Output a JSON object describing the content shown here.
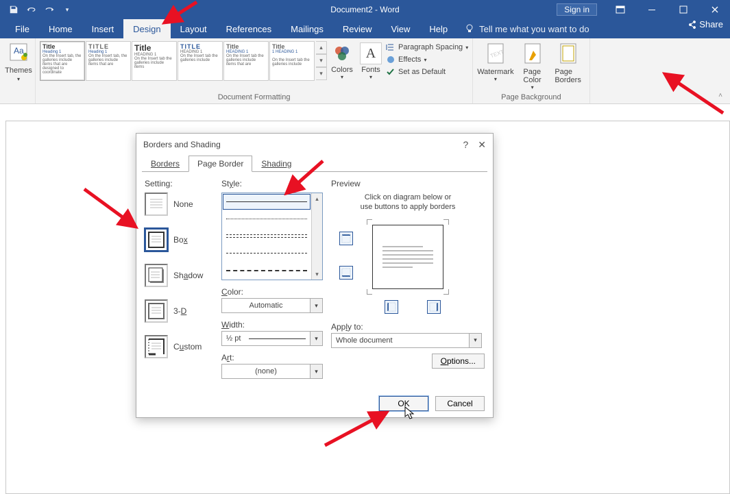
{
  "titlebar": {
    "title": "Document2 - Word",
    "signin": "Sign in"
  },
  "tabs": {
    "file": "File",
    "home": "Home",
    "insert": "Insert",
    "design": "Design",
    "layout": "Layout",
    "references": "References",
    "mailings": "Mailings",
    "review": "Review",
    "view": "View",
    "help": "Help",
    "tellme": "Tell me what you want to do",
    "share": "Share"
  },
  "ribbon": {
    "themes": "Themes",
    "group_docfmt": "Document Formatting",
    "colors": "Colors",
    "fonts": "Fonts",
    "para_spacing": "Paragraph Spacing",
    "effects": "Effects",
    "set_default": "Set as Default",
    "watermark": "Watermark",
    "page_color": "Page Color",
    "page_borders": "Page Borders",
    "group_pagebg": "Page Background",
    "gal_title1": "Title",
    "gal_heading1": "Heading 1",
    "gal_title2": "TITLE",
    "gal_title3": "Title",
    "gal_heading3": "HEADING 1",
    "gal_title4": "TITLE",
    "gal_heading4": "HEADING 1",
    "gal_title5": "Title",
    "gal_heading5": "HEADING 1",
    "gal_title6": "Title",
    "gal_heading6": "1 HEADING 1"
  },
  "dialog": {
    "title": "Borders and Shading",
    "tab_borders": "Borders",
    "tab_page": "Page Border",
    "tab_shading": "Shading",
    "setting": "Setting:",
    "none": "None",
    "box": "Box",
    "shadow": "Shadow",
    "threeD": "3-D",
    "custom": "Custom",
    "style": "Style:",
    "color": "Color:",
    "color_val": "Automatic",
    "width": "Width:",
    "width_val": "½ pt",
    "art": "Art:",
    "art_val": "(none)",
    "preview": "Preview",
    "preview_hint1": "Click on diagram below or",
    "preview_hint2": "use buttons to apply borders",
    "apply_to": "Apply to:",
    "apply_val": "Whole document",
    "options": "Options...",
    "ok": "OK",
    "cancel": "Cancel"
  }
}
